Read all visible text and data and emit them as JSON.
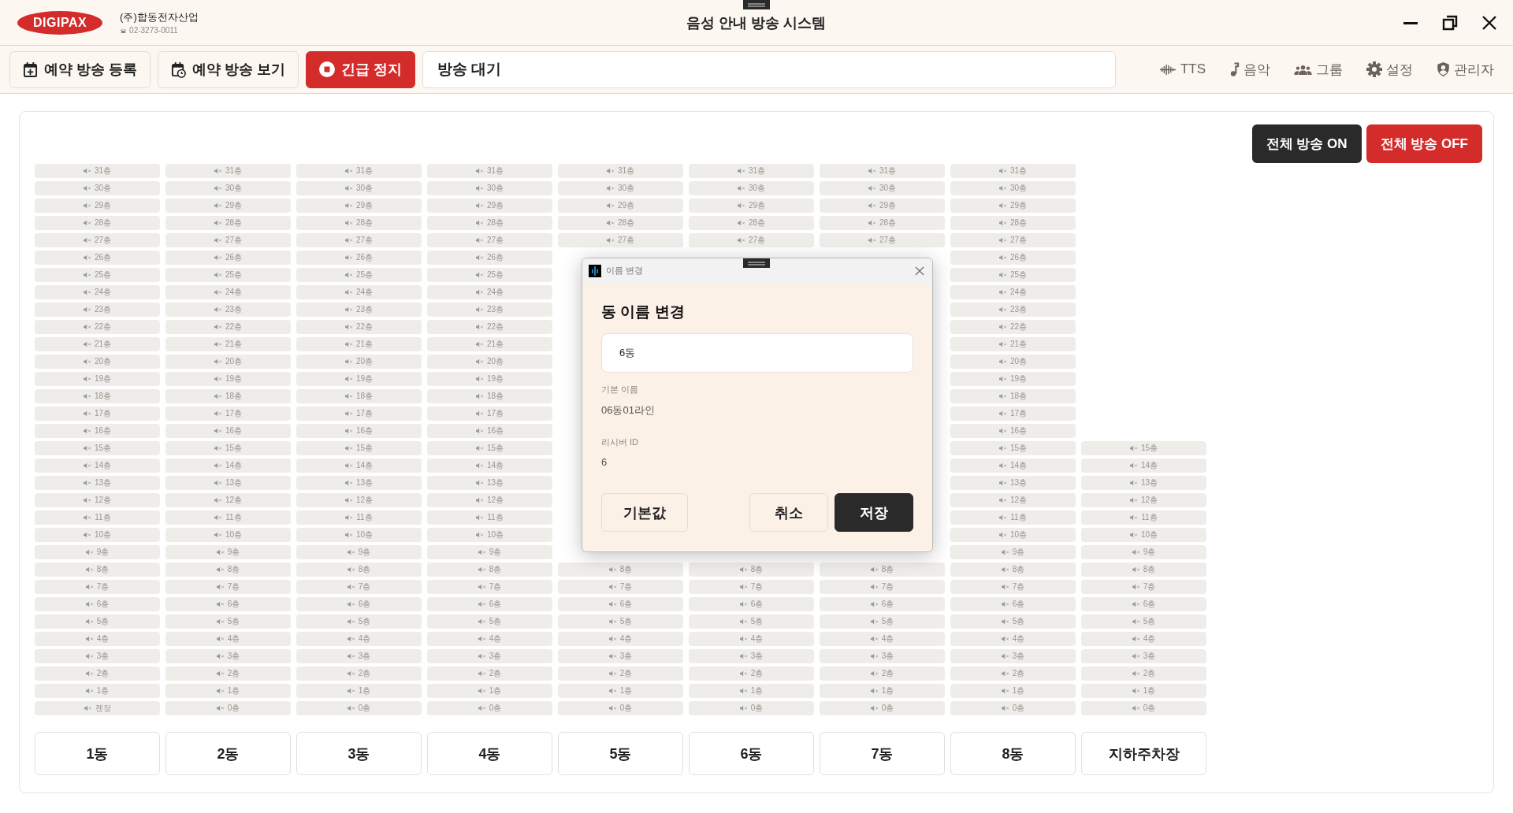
{
  "window": {
    "title": "음성 안내 방송 시스템"
  },
  "logo": {
    "text": "DIGIPAX"
  },
  "company": {
    "name": "(주)합동전자산업",
    "phone": "02-3273-0011"
  },
  "toolbar": {
    "buttons": [
      {
        "label": "예약 방송 등록",
        "kind": "register"
      },
      {
        "label": "예약 방송 보기",
        "kind": "view"
      },
      {
        "label": "긴급 정지",
        "kind": "stop"
      }
    ],
    "status": "방송 대기",
    "menu": [
      {
        "label": "TTS",
        "kind": "tts"
      },
      {
        "label": "음악",
        "kind": "music"
      },
      {
        "label": "그룹",
        "kind": "group"
      },
      {
        "label": "설정",
        "kind": "settings"
      },
      {
        "label": "관리자",
        "kind": "admin"
      }
    ]
  },
  "broadcast_all": [
    {
      "label": "전체 방송 ON",
      "kind": "on"
    },
    {
      "label": "전체 방송 OFF",
      "kind": "off"
    }
  ],
  "buildings": [
    {
      "name": "1동",
      "floors": [
        "31층",
        "30층",
        "29층",
        "28층",
        "27층",
        "26층",
        "25층",
        "24층",
        "23층",
        "22층",
        "21층",
        "20층",
        "19층",
        "18층",
        "17층",
        "16층",
        "15층",
        "14층",
        "13층",
        "12층",
        "11층",
        "10층",
        "9층",
        "8층",
        "7층",
        "6층",
        "5층",
        "4층",
        "3층",
        "2층",
        "1층",
        "젠장"
      ]
    },
    {
      "name": "2동",
      "floors": [
        "31층",
        "30층",
        "29층",
        "28층",
        "27층",
        "26층",
        "25층",
        "24층",
        "23층",
        "22층",
        "21층",
        "20층",
        "19층",
        "18층",
        "17층",
        "16층",
        "15층",
        "14층",
        "13층",
        "12층",
        "11층",
        "10층",
        "9층",
        "8층",
        "7층",
        "6층",
        "5층",
        "4층",
        "3층",
        "2층",
        "1층",
        "0층"
      ]
    },
    {
      "name": "3동",
      "floors": [
        "31층",
        "30층",
        "29층",
        "28층",
        "27층",
        "26층",
        "25층",
        "24층",
        "23층",
        "22층",
        "21층",
        "20층",
        "19층",
        "18층",
        "17층",
        "16층",
        "15층",
        "14층",
        "13층",
        "12층",
        "11층",
        "10층",
        "9층",
        "8층",
        "7층",
        "6층",
        "5층",
        "4층",
        "3층",
        "2층",
        "1층",
        "0층"
      ]
    },
    {
      "name": "4동",
      "floors": [
        "31층",
        "30층",
        "29층",
        "28층",
        "27층",
        "26층",
        "25층",
        "24층",
        "23층",
        "22층",
        "21층",
        "20층",
        "19층",
        "18층",
        "17층",
        "16층",
        "15층",
        "14층",
        "13층",
        "12층",
        "11층",
        "10층",
        "9층",
        "8층",
        "7층",
        "6층",
        "5층",
        "4층",
        "3층",
        "2층",
        "1층",
        "0층"
      ]
    },
    {
      "name": "5동",
      "floors_top": [
        "31층",
        "30층",
        "29층",
        "28층",
        "27층"
      ],
      "floors_bottom": [
        "8층",
        "7층",
        "6층",
        "5층",
        "4층",
        "3층",
        "2층",
        "1층",
        "0층"
      ]
    },
    {
      "name": "6동",
      "floors_top": [
        "31층",
        "30층",
        "29층",
        "28층",
        "27층"
      ],
      "floors_bottom": [
        "8층",
        "7층",
        "6층",
        "5층",
        "4층",
        "3층",
        "2층",
        "1층",
        "0층"
      ]
    },
    {
      "name": "7동",
      "floors_top": [
        "31층",
        "30층",
        "29층",
        "28층",
        "27층"
      ],
      "floors_bottom": [
        "8층",
        "7층",
        "6층",
        "5층",
        "4층",
        "3층",
        "2층",
        "1층",
        "0층"
      ]
    },
    {
      "name": "8동",
      "floors": [
        "31층",
        "30층",
        "29층",
        "28층",
        "27층",
        "26층",
        "25층",
        "24층",
        "23층",
        "22층",
        "21층",
        "20층",
        "19층",
        "18층",
        "17층",
        "16층",
        "15층",
        "14층",
        "13층",
        "12층",
        "11층",
        "10층",
        "9층",
        "8층",
        "7층",
        "6층",
        "5층",
        "4층",
        "3층",
        "2층",
        "1층",
        "0층"
      ]
    },
    {
      "name": "지하주차장",
      "floors": [
        "15층",
        "14층",
        "13층",
        "12층",
        "11층",
        "10층",
        "9층",
        "8층",
        "7층",
        "6층",
        "5층",
        "4층",
        "3층",
        "2층",
        "1층",
        "0층"
      ]
    }
  ],
  "dialog": {
    "title": "이름 변경",
    "heading": "동 이름 변경",
    "name_field": {
      "value": "6동"
    },
    "fields": [
      {
        "label": "기본 이름",
        "value": "06동01라인"
      },
      {
        "label": "리시버 ID",
        "value": "6"
      }
    ],
    "buttons": [
      {
        "label": "기본값",
        "kind": "default"
      },
      {
        "label": "취소",
        "kind": "cancel"
      },
      {
        "label": "저장",
        "kind": "save"
      }
    ]
  }
}
